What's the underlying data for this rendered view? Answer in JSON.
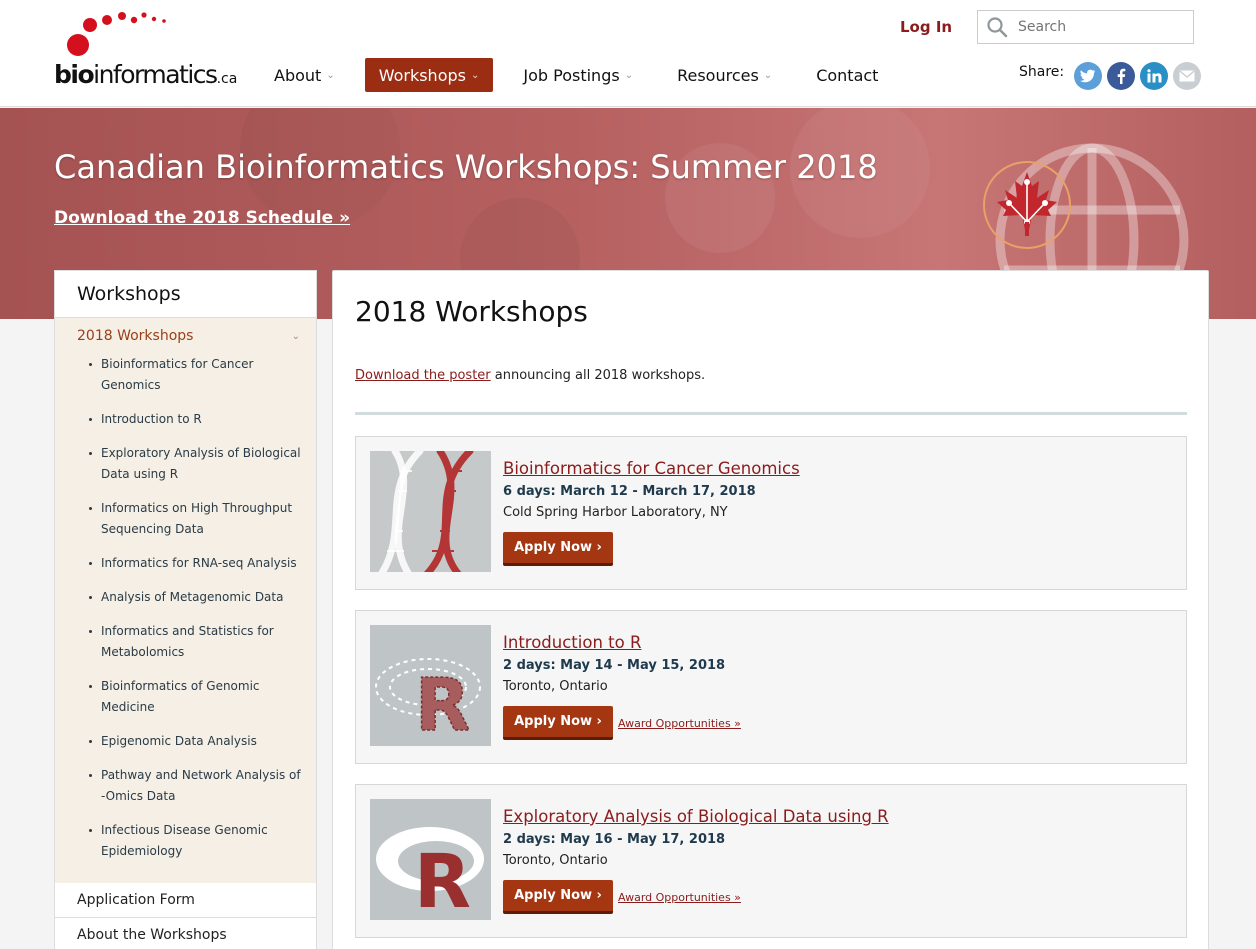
{
  "header": {
    "logo": {
      "bio": "bio",
      "rest": "informatics",
      "tld": ".ca"
    },
    "login_label": "Log In",
    "search_placeholder": "Search",
    "share_label": "Share:",
    "share_icons": [
      "twitter-icon",
      "facebook-icon",
      "linkedin-icon",
      "email-icon"
    ]
  },
  "nav": {
    "items": [
      {
        "label": "About",
        "has_dropdown": true
      },
      {
        "label": "Workshops",
        "has_dropdown": true,
        "active": true
      },
      {
        "label": "Job Postings",
        "has_dropdown": true
      },
      {
        "label": "Resources",
        "has_dropdown": true
      },
      {
        "label": "Contact",
        "has_dropdown": false
      }
    ]
  },
  "hero": {
    "title": "Canadian Bioinformatics Workshops: Summer 2018",
    "link": "Download the 2018 Schedule »"
  },
  "sidebar": {
    "title": "Workshops",
    "active_section": "2018 Workshops",
    "items": [
      "Bioinformatics for Cancer Genomics",
      "Introduction to R",
      "Exploratory Analysis of Biological Data using R",
      "Informatics on High Throughput Sequencing Data",
      "Informatics for RNA-seq Analysis",
      "Analysis of Metagenomic Data",
      "Informatics and Statistics for Metabolomics",
      "Bioinformatics of Genomic Medicine",
      "Epigenomic Data Analysis",
      "Pathway and Network Analysis of -Omics Data",
      "Infectious Disease Genomic Epidemiology"
    ],
    "links": [
      "Application Form",
      "About the Workshops"
    ]
  },
  "main": {
    "title": "2018 Workshops",
    "intro_link": "Download the poster",
    "intro_text": " announcing all 2018 workshops.",
    "workshops": [
      {
        "title": "Bioinformatics for Cancer Genomics",
        "dates": "6 days: March 12 - March 17, 2018",
        "location": "Cold Spring Harbor Laboratory, NY",
        "apply": "Apply Now ›",
        "award": ""
      },
      {
        "title": "Introduction to R",
        "dates": "2 days: May 14 - May 15, 2018",
        "location": "Toronto, Ontario",
        "apply": "Apply Now ›",
        "award": "Award Opportunities »"
      },
      {
        "title": "Exploratory Analysis of Biological Data using R",
        "dates": "2 days: May 16 - May 17, 2018",
        "location": "Toronto, Ontario",
        "apply": "Apply Now ›",
        "award": "Award Opportunities »"
      }
    ]
  },
  "colors": {
    "brand_red": "#8a1c1c",
    "button_red": "#a43712",
    "nav_active": "#9a2d12",
    "hero_bg": "#b05a5a",
    "sidebar_bg": "#f5efe6"
  }
}
